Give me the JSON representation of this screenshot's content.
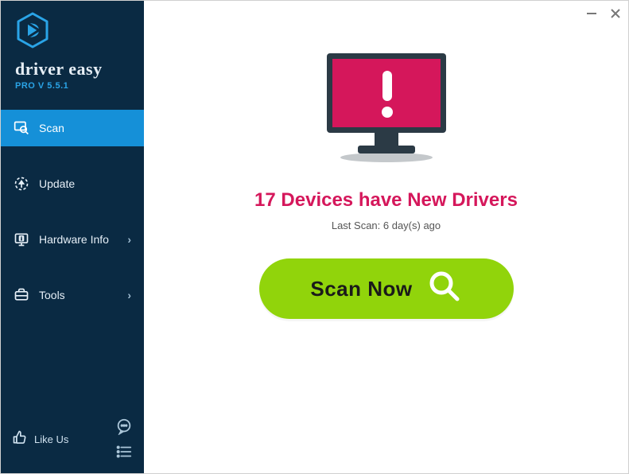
{
  "brand": {
    "name": "driver easy",
    "version": "PRO V 5.5.1"
  },
  "sidebar": {
    "items": [
      {
        "label": "Scan",
        "hasChevron": false
      },
      {
        "label": "Update",
        "hasChevron": false
      },
      {
        "label": "Hardware Info",
        "hasChevron": true
      },
      {
        "label": "Tools",
        "hasChevron": true
      }
    ],
    "footer": {
      "likeLabel": "Like Us"
    }
  },
  "main": {
    "statusText": "17 Devices have New Drivers",
    "lastScan": "Last Scan: 6 day(s) ago",
    "scanButtonLabel": "Scan Now"
  },
  "colors": {
    "sidebarBg": "#0a2a43",
    "activeBg": "#1590d8",
    "alert": "#d5175b",
    "scanBtn": "#91d40b"
  }
}
